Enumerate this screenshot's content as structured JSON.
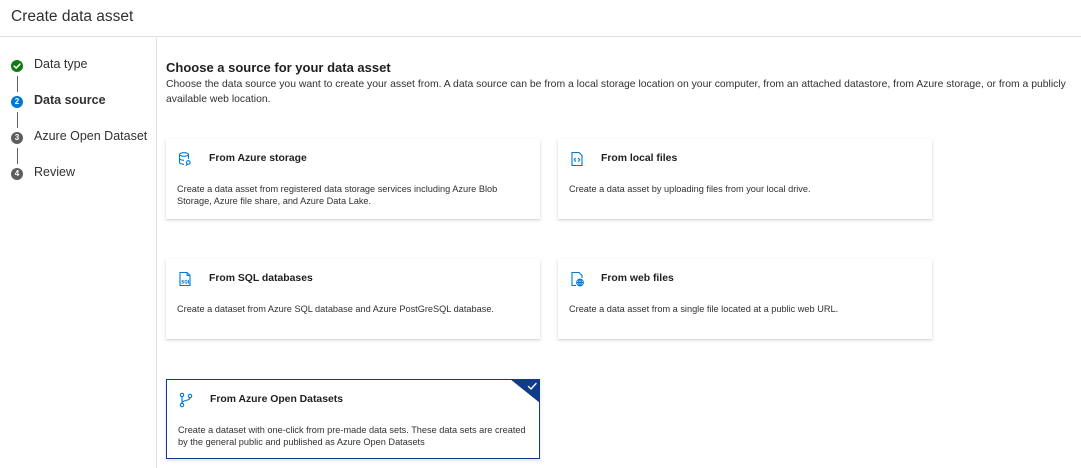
{
  "header": {
    "title": "Create data asset"
  },
  "wizard": {
    "steps": [
      {
        "label": "Data type",
        "number": "",
        "state": "done"
      },
      {
        "label": "Data source",
        "number": "2",
        "state": "current"
      },
      {
        "label": "Azure Open Dataset",
        "number": "3",
        "state": "pending"
      },
      {
        "label": "Review",
        "number": "4",
        "state": "pending"
      }
    ]
  },
  "main": {
    "title": "Choose a source for your data asset",
    "description": "Choose the data source you want to create your asset from. A data source can be from a local storage location on your computer, from an attached datastore, from Azure storage, or from a publicly available web location.",
    "cards": [
      {
        "title": "From Azure storage",
        "description": "Create a data asset from registered data storage services including Azure Blob Storage, Azure file share, and Azure Data Lake.",
        "icon": "azure-storage-icon",
        "selected": false
      },
      {
        "title": "From local files",
        "description": "Create a data asset by uploading files from your local drive.",
        "icon": "local-files-icon",
        "selected": false
      },
      {
        "title": "From SQL databases",
        "description": "Create a dataset from Azure SQL database and Azure PostGreSQL database.",
        "icon": "sql-file-icon",
        "selected": false
      },
      {
        "title": "From web files",
        "description": "Create a data asset from a single file located at a public web URL.",
        "icon": "web-file-icon",
        "selected": false
      },
      {
        "title": "From Azure Open Datasets",
        "description": "Create a dataset with one-click from pre-made data sets. These data sets are created by the general public and published as Azure Open Datasets",
        "icon": "branch-icon",
        "selected": true
      }
    ]
  },
  "colors": {
    "accent": "#0078d4",
    "selected_border": "#0f3b8a",
    "step_done": "#107c10",
    "step_pending": "#605e5c"
  }
}
